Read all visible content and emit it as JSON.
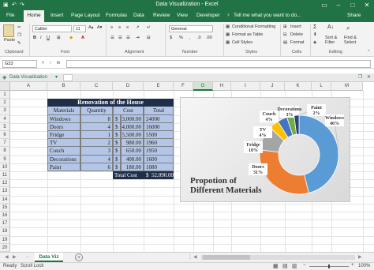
{
  "window": {
    "title": "Data Visualization - Excel",
    "user": "Sign in"
  },
  "menu": {
    "file": "File",
    "home": "Home",
    "insert": "Insert",
    "page_layout": "Page Layout",
    "formulas": "Formulas",
    "data": "Data",
    "review": "Review",
    "view": "View",
    "developer": "Developer",
    "tell_me": "Tell me what you want to do...",
    "share": "Share"
  },
  "ribbon": {
    "clipboard": {
      "paste": "Paste",
      "label": "Clipboard"
    },
    "font": {
      "name": "Calibri",
      "size": "11",
      "label": "Font"
    },
    "alignment": {
      "label": "Alignment"
    },
    "number": {
      "format": "General",
      "label": "Number",
      "dollar": "$",
      "percent": "%"
    },
    "styles": {
      "cond": "Conditional Formatting",
      "table": "Format as Table",
      "cell": "Cell Styles",
      "label": "Styles"
    },
    "cells": {
      "insert": "Insert",
      "delete": "Delete",
      "format": "Format",
      "label": "Cells"
    },
    "editing": {
      "sum": "Σ",
      "sort": "Sort & Filter",
      "find": "Find & Select",
      "label": "Editing"
    }
  },
  "formula_bar": {
    "name_box": "G33",
    "fx": "fx",
    "cancel": "✕",
    "enter": "✓",
    "value": ""
  },
  "tab_strip": {
    "label": "Data Visualization"
  },
  "columns": [
    "A",
    "B",
    "C",
    "D",
    "E",
    "F",
    "G",
    "H",
    "I",
    "J",
    "K",
    "L",
    "M"
  ],
  "rows": [
    "1",
    "2",
    "3",
    "4",
    "5",
    "6",
    "7",
    "8",
    "9",
    "10",
    "11",
    "12",
    "13",
    "14",
    "15",
    "16",
    "17",
    "18",
    "19",
    "20",
    "21"
  ],
  "table": {
    "title": "Renovation of the House",
    "headers": [
      "Materials",
      "Quantity",
      "Cost",
      "Total"
    ],
    "items": [
      {
        "material": "Windows",
        "qty": "8",
        "cur": "$",
        "cost": "3,000.00",
        "total": "24000"
      },
      {
        "material": "Doors",
        "qty": "4",
        "cur": "$",
        "cost": "4,000.00",
        "total": "16000"
      },
      {
        "material": "Fridge",
        "qty": "1",
        "cur": "$",
        "cost": "5,500.00",
        "total": "5500"
      },
      {
        "material": "TV",
        "qty": "2",
        "cur": "$",
        "cost": "980.00",
        "total": "1960"
      },
      {
        "material": "Couch",
        "qty": "3",
        "cur": "$",
        "cost": "650.00",
        "total": "1950"
      },
      {
        "material": "Decorations",
        "qty": "4",
        "cur": "$",
        "cost": "400.00",
        "total": "1600"
      },
      {
        "material": "Paint",
        "qty": "6",
        "cur": "$",
        "cost": "180.00",
        "total": "1080"
      }
    ],
    "total_label": "Total Cost",
    "total_cur": "$",
    "total_value": "52,090.00"
  },
  "chart_data": {
    "type": "pie",
    "title": "Propotion of Different Materials",
    "title_line1": "Propotion of",
    "title_line2": "Different Materials",
    "labels": [
      {
        "name": "Windows",
        "pct": "46%"
      },
      {
        "name": "Doors",
        "pct": "31%"
      },
      {
        "name": "Fridge",
        "pct": "10%"
      },
      {
        "name": "TV",
        "pct": "4%"
      },
      {
        "name": "Couch",
        "pct": "4%"
      },
      {
        "name": "Decorations",
        "pct": "3%"
      },
      {
        "name": "Paint",
        "pct": "2%"
      }
    ],
    "values": [
      46,
      31,
      10,
      4,
      4,
      3,
      2
    ],
    "colors": [
      "#5b9bd5",
      "#ed7d31",
      "#a5a5a5",
      "#ffc000",
      "#4472c4",
      "#70ad47",
      "#264478"
    ]
  },
  "sheet_tabs": {
    "active": "Data Viz",
    "add": "+"
  },
  "status": {
    "ready": "Ready",
    "scroll_lock": "Scroll Lock",
    "zoom": "100%",
    "minus": "−",
    "plus": "+"
  }
}
